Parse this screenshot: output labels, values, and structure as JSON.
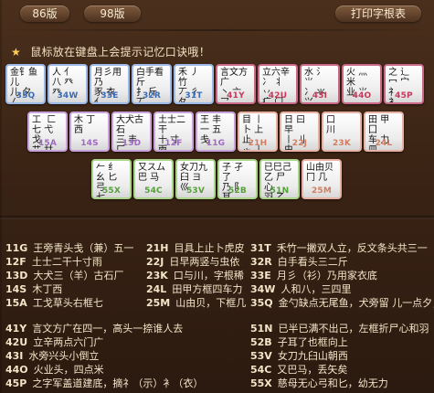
{
  "tabs": {
    "v86": "86版",
    "v98": "98版"
  },
  "print_button": "打印字根表",
  "hint": "鼠标放在键盘上会提示记忆口诀哦！",
  "keys": {
    "row1": [
      {
        "code": "35Q",
        "roots": "金钅鱼儿\n儿 夕 ㄥ\n又 氏",
        "group": "c1"
      },
      {
        "code": "34W",
        "roots": "人 亻\n八 癶 癶",
        "group": "c1"
      },
      {
        "code": "33E",
        "roots": "月彡用乃\n豕 衣 亻\n丬 乃 化",
        "group": "c1"
      },
      {
        "code": "32R",
        "roots": "白手看斤\n扌 斤 丆\n丆 乂",
        "group": "c1"
      },
      {
        "code": "31T",
        "roots": "禾 丿 竹\n丆 彳 夂\n攵 冬",
        "group": "c1"
      },
      {
        "code": "41Y",
        "roots": "言文方广\n丶 亠 乛\n亻 亠 冖",
        "group": "c2"
      },
      {
        "code": "42U",
        "roots": "立六辛\n冫 丬 丷\n疒 门",
        "group": "c2"
      },
      {
        "code": "43I",
        "roots": "水 氵 ⺌\n冫 氺 ⺍\n小 业",
        "group": "c2"
      },
      {
        "code": "44O",
        "roots": "火 灬 米\n业 ⺌",
        "group": "c2"
      },
      {
        "code": "45P",
        "roots": "之 辶\n冖 宀 礻\n衤",
        "group": "c2"
      }
    ],
    "row2": [
      {
        "code": "15A",
        "roots": "工  匚\n七 弋 戈\n艹 廿",
        "group": "c3"
      },
      {
        "code": "14S",
        "roots": "木 丁\n西",
        "group": "c3"
      },
      {
        "code": "13D",
        "roots": "大犬古石\n三 丰 厂\n𠂇 厂",
        "group": "c3"
      },
      {
        "code": "12F",
        "roots": "土士二干\n十 寸 雨\n革",
        "group": "c3"
      },
      {
        "code": "11G",
        "roots": "王 丰\n一 五\n戋",
        "group": "c3"
      },
      {
        "code": "21H",
        "roots": "目 丨\n卜 上 止\n龰 丨",
        "group": "c4"
      },
      {
        "code": "22J",
        "roots": "日 曰 早\n丨 刂 虫\n川",
        "group": "c4"
      },
      {
        "code": "23K",
        "roots": "口\n川",
        "group": "c4"
      },
      {
        "code": "24L",
        "roots": "田 甲 囗\n车 力\n皿",
        "group": "c4"
      }
    ],
    "row3": [
      {
        "code": "55X",
        "roots": "𠂉 纟\n幺 匕 弓\n七",
        "group": "c5"
      },
      {
        "code": "54C",
        "roots": "又スム\n巴 马",
        "group": "c5"
      },
      {
        "code": "53V",
        "roots": "女刀九\n臼 ヨ\n巛",
        "group": "c5"
      },
      {
        "code": "52B",
        "roots": "子 孑 了\n乃 阝 耳\n卩 凵",
        "group": "c5"
      },
      {
        "code": "51N",
        "roots": "已巳己\n乙 尸 心\n羽 乙",
        "group": "c5"
      },
      {
        "code": "25M",
        "roots": "山由贝\n冂 几",
        "group": "c4"
      }
    ]
  },
  "legend": {
    "col_a": [
      {
        "code": "11G",
        "text": "王旁青头戋（兼）五一"
      },
      {
        "code": "12F",
        "text": "土士二干十寸雨"
      },
      {
        "code": "13D",
        "text": "大犬三（羊）古石厂"
      },
      {
        "code": "14S",
        "text": "木丁西"
      },
      {
        "code": "15A",
        "text": "工戈草头右框七"
      }
    ],
    "col_b": [
      {
        "code": "21H",
        "text": "目具上止卜虎皮"
      },
      {
        "code": "22J",
        "text": "日早两竖与虫依"
      },
      {
        "code": "23K",
        "text": "口与川，字根稀"
      },
      {
        "code": "24L",
        "text": "田甲方框四车力"
      },
      {
        "code": "25M",
        "text": "山由贝，下框几"
      }
    ],
    "col_c": [
      {
        "code": "31T",
        "text": "禾竹一撇双人立，反文条头共三一"
      },
      {
        "code": "32R",
        "text": "白手看头三二斤"
      },
      {
        "code": "33E",
        "text": "月彡（衫）乃用家衣底"
      },
      {
        "code": "34W",
        "text": "人和八，三四里"
      },
      {
        "code": "35Q",
        "text": "金勺缺点无尾鱼，犬旁留 儿一点夕，氏无七（妻）"
      }
    ],
    "col_d": [
      {
        "code": "41Y",
        "text": "言文方广在四一，高头一捺谁人去"
      },
      {
        "code": "42U",
        "text": "立辛两点六门广"
      },
      {
        "code": "43I",
        "text": "水旁兴头小倒立"
      },
      {
        "code": "44O",
        "text": "火业头，四点米"
      },
      {
        "code": "45P",
        "text": "之字军盖道建底，摘礻（示）衤（衣）"
      }
    ],
    "col_e": [
      {
        "code": "51N",
        "text": "已半已满不出己，左框折尸心和羽"
      },
      {
        "code": "52B",
        "text": "子耳了也框向上"
      },
      {
        "code": "53V",
        "text": "女刀九臼山朝西"
      },
      {
        "code": "54C",
        "text": "又巴马，丢矢矣"
      },
      {
        "code": "55X",
        "text": "慈母无心弓和匕，幼无力"
      }
    ]
  }
}
